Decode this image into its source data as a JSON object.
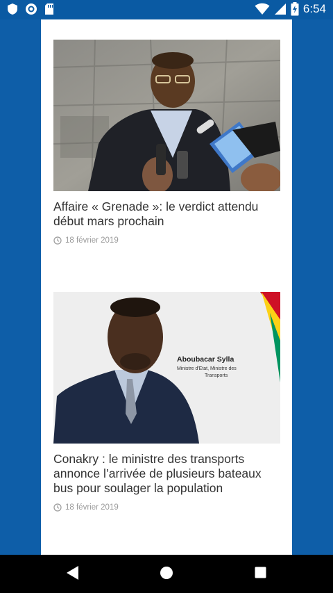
{
  "status_bar": {
    "time": "6:54",
    "left_icons": [
      "shield-icon",
      "circle-icon",
      "sd-card-icon"
    ],
    "right_icons": [
      "wifi-icon",
      "signal-icon",
      "battery-icon"
    ]
  },
  "articles": [
    {
      "title": "Affaire « Grenade »: le verdict attendu début mars prochain",
      "date": "18 février 2019",
      "image": {
        "icon": "photo-man-interviewed"
      }
    },
    {
      "title": "Conakry : le ministre des transports annonce l’arrivée de plusieurs bateaux bus pour soulager la population",
      "date": "18 février 2019",
      "image": {
        "icon": "photo-minister-portrait",
        "caption_name": "Aboubacar Sylla",
        "caption_role_line1": "Ministre d'Etat, Ministre des",
        "caption_role_line2": "Transports"
      }
    }
  ],
  "nav_bar": {
    "buttons": [
      "back-icon",
      "home-icon",
      "recents-icon"
    ]
  }
}
